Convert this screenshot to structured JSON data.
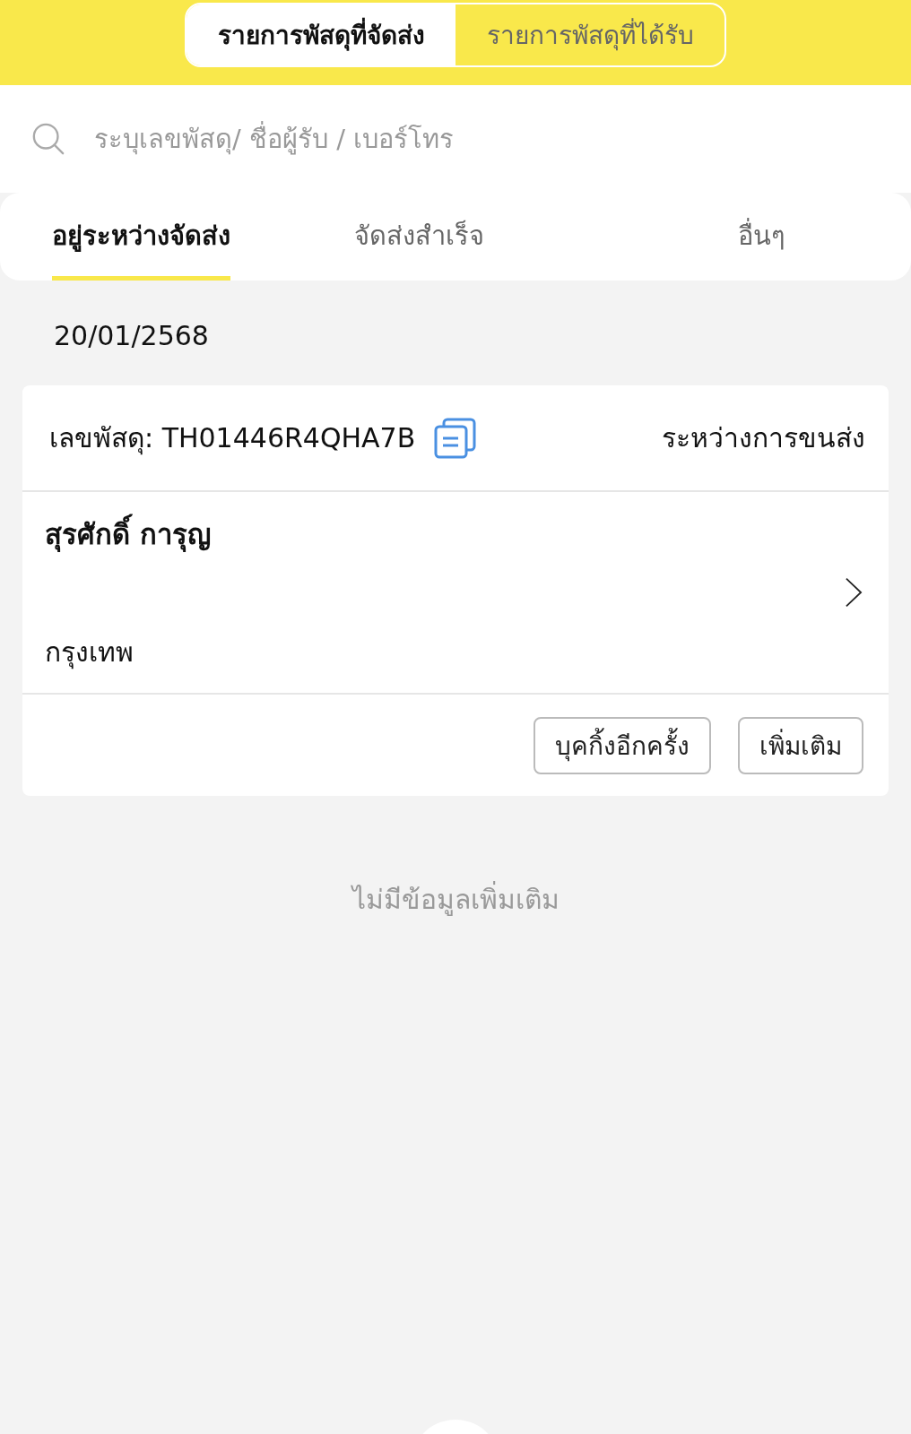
{
  "segments": [
    {
      "label": "รายการพัสดุที่จัดส่ง",
      "selected": true
    },
    {
      "label": "รายการพัสดุที่ได้รับ",
      "selected": false
    }
  ],
  "search": {
    "placeholder": "ระบุเลขพัสดุ/ ชื่อผู้รับ / เบอร์โทร"
  },
  "tabs": [
    {
      "label": "อยู่ระหว่างจัดส่ง",
      "selected": true
    },
    {
      "label": "จัดส่งสำเร็จ",
      "selected": false
    },
    {
      "label": "อื่นๆ",
      "selected": false
    }
  ],
  "date": "20/01/2568",
  "shipments": [
    {
      "tracking": "เลขพัสดุ: TH01446R4QHA7B",
      "status": "ระหว่างการขนส่ง",
      "recipient": "สุรศักดิ์ การุญ",
      "city": "กรุงเทพ",
      "buttons": [
        "บุคกิ้งอีกครั้ง",
        "เพิ่มเติม"
      ]
    }
  ],
  "empty_message": "ไม่มีข้อมูลเพิ่มเติม"
}
